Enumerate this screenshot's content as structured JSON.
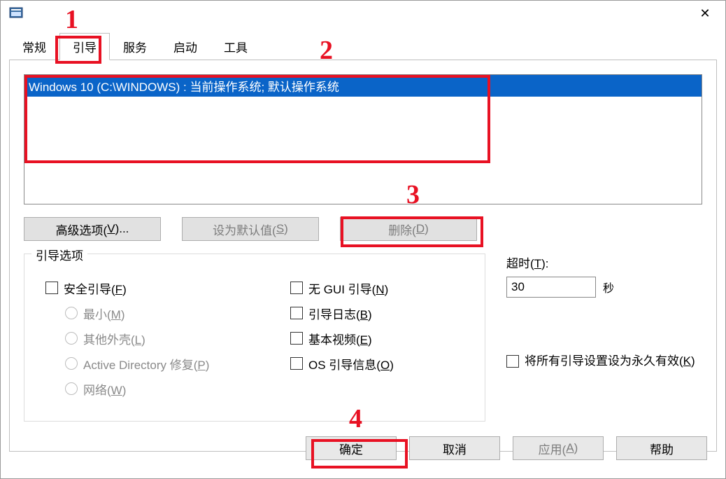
{
  "tabs": {
    "general": "常规",
    "boot": "引导",
    "services": "服务",
    "startup": "启动",
    "tools": "工具"
  },
  "bootlist": {
    "row0": "Windows 10 (C:\\WINDOWS) : 当前操作系统; 默认操作系统"
  },
  "buttons": {
    "advanced_pre": "高级选项(",
    "advanced_key": "V",
    "advanced_post": ")...",
    "setdefault_pre": "设为默认值(",
    "setdefault_key": "S",
    "setdefault_post": ")",
    "delete_pre": "删除(",
    "delete_key": "D",
    "delete_post": ")"
  },
  "group": {
    "bootopts_legend": "引导选项",
    "safeboot_pre": "安全引导(",
    "safeboot_key": "F",
    "safeboot_post": ")",
    "minimal_pre": "最小(",
    "minimal_key": "M",
    "minimal_post": ")",
    "altshell_pre": "其他外壳(",
    "altshell_key": "L",
    "altshell_post": ")",
    "adrepair_pre": "Active Directory 修复(",
    "adrepair_key": "P",
    "adrepair_post": ")",
    "network_pre": "网络(",
    "network_key": "W",
    "network_post": ")",
    "nogui_pre": "无 GUI 引导(",
    "nogui_key": "N",
    "nogui_post": ")",
    "bootlog_pre": "引导日志(",
    "bootlog_key": "B",
    "bootlog_post": ")",
    "basevideo_pre": "基本视频(",
    "basevideo_key": "E",
    "basevideo_post": ")",
    "osinfo_pre": "OS 引导信息(",
    "osinfo_key": "O",
    "osinfo_post": ")"
  },
  "timeout": {
    "label_pre": "超时(",
    "label_key": "T",
    "label_post": "):",
    "value": "30",
    "unit": "秒"
  },
  "perm": {
    "label_pre": "将所有引导设置设为永久有效(",
    "label_key": "K",
    "label_post": ")"
  },
  "dlg": {
    "ok": "确定",
    "cancel": "取消",
    "apply_pre": "应用(",
    "apply_key": "A",
    "apply_post": ")",
    "help": "帮助"
  },
  "annotations": {
    "n1": "1",
    "n2": "2",
    "n3": "3",
    "n4": "4"
  }
}
